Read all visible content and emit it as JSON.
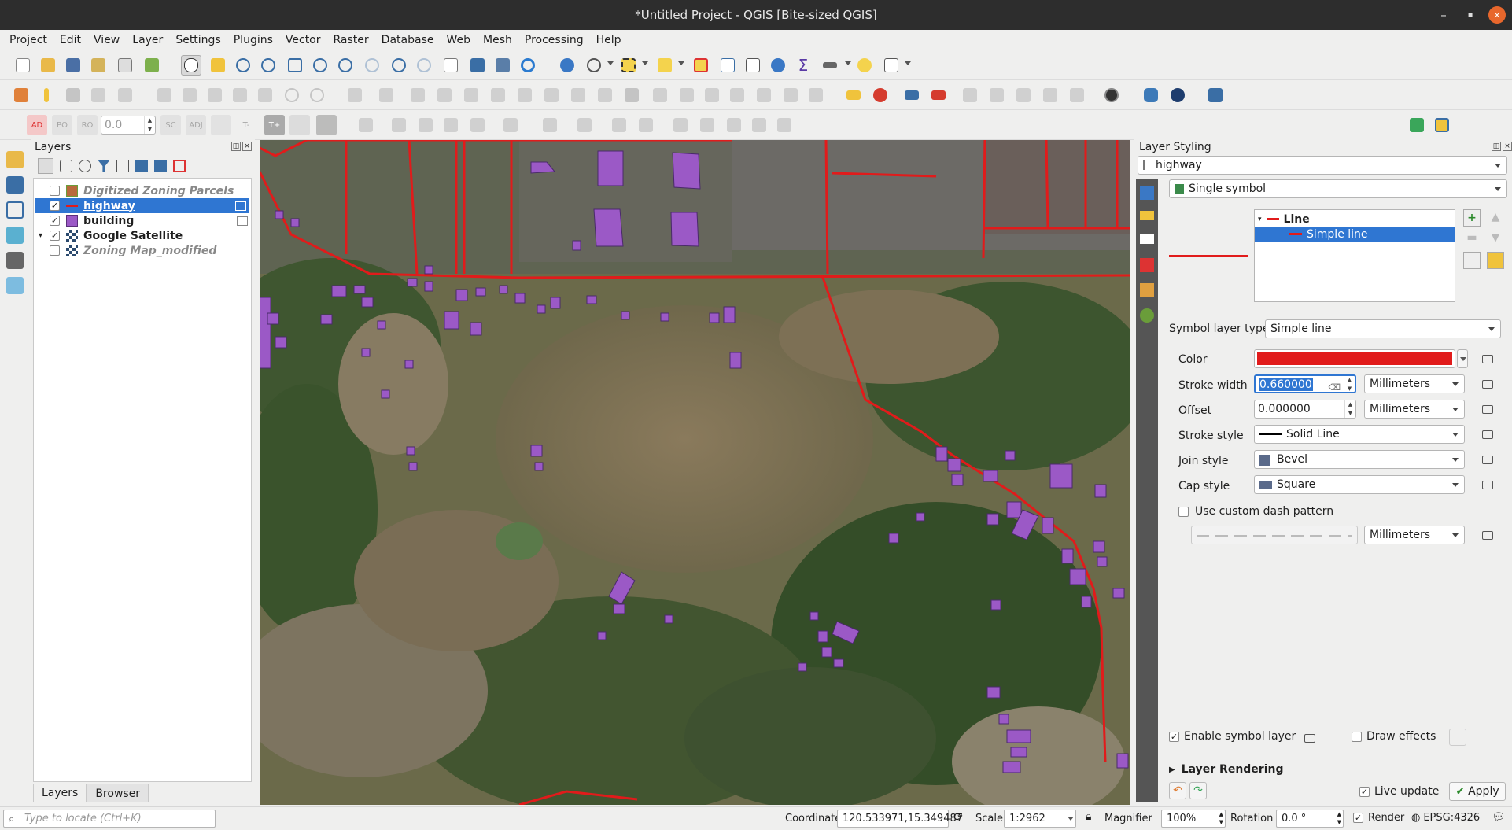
{
  "window": {
    "title": "*Untitled Project - QGIS [Bite-sized QGIS]",
    "minimize": "–",
    "maximize": "▪",
    "close": "×"
  },
  "menu": [
    "Project",
    "Edit",
    "View",
    "Layer",
    "Settings",
    "Plugins",
    "Vector",
    "Raster",
    "Database",
    "Web",
    "Mesh",
    "Processing",
    "Help"
  ],
  "digitizing": {
    "advanced_labels": [
      "AD",
      "PO",
      "RO"
    ],
    "value": "0.0",
    "labels2": [
      "SC",
      "ADJ",
      "T+",
      "T-"
    ]
  },
  "layers_panel": {
    "title": "Layers",
    "layers": [
      {
        "name": "Digitized Zoning Parcels",
        "checked": false,
        "style": "italic-bold-gray",
        "icon": "raster-layer-icon"
      },
      {
        "name": "highway",
        "checked": true,
        "style": "selected",
        "icon": "line-layer-icon"
      },
      {
        "name": "building",
        "checked": true,
        "style": "bold",
        "icon": "polygon-layer-icon"
      },
      {
        "name": "Google Satellite",
        "checked": true,
        "style": "bold",
        "icon": "tile-layer-icon"
      },
      {
        "name": "Zoning Map_modified",
        "checked": false,
        "style": "italic-bold-gray",
        "icon": "tile-layer-icon"
      }
    ],
    "tabs": [
      "Layers",
      "Browser"
    ]
  },
  "styling_panel": {
    "title": "Layer Styling",
    "layer": "highway",
    "renderer": "Single symbol",
    "tree": {
      "root": "Line",
      "child": "Simple line"
    },
    "symbol_layer_type_label": "Symbol layer type",
    "symbol_layer_type": "Simple line",
    "fields": {
      "color_label": "Color",
      "color_value": "#e11b1b",
      "stroke_width_label": "Stroke width",
      "stroke_width": "0.660000",
      "stroke_width_unit": "Millimeters",
      "offset_label": "Offset",
      "offset": "0.000000",
      "offset_unit": "Millimeters",
      "stroke_style_label": "Stroke style",
      "stroke_style": "Solid Line",
      "join_style_label": "Join style",
      "join_style": "Bevel",
      "cap_style_label": "Cap style",
      "cap_style": "Square",
      "custom_dash_label": "Use custom dash pattern",
      "dash_unit": "Millimeters"
    },
    "enable_symbol_layer": "Enable symbol layer",
    "draw_effects": "Draw effects",
    "layer_rendering": "Layer Rendering",
    "live_update": "Live update",
    "apply": "Apply"
  },
  "statusbar": {
    "locator_placeholder": "Type to locate (Ctrl+K)",
    "coordinate_label": "Coordinate",
    "coordinate": "120.533971,15.349487",
    "scale_label": "Scale",
    "scale": "1:2962",
    "magnifier_label": "Magnifier",
    "magnifier": "100%",
    "rotation_label": "Rotation",
    "rotation": "0.0 °",
    "render_label": "Render",
    "crs": "EPSG:4326"
  },
  "colors": {
    "highway": "#e11b1b",
    "building": "#9b59c6",
    "selection": "#2f76d2"
  }
}
